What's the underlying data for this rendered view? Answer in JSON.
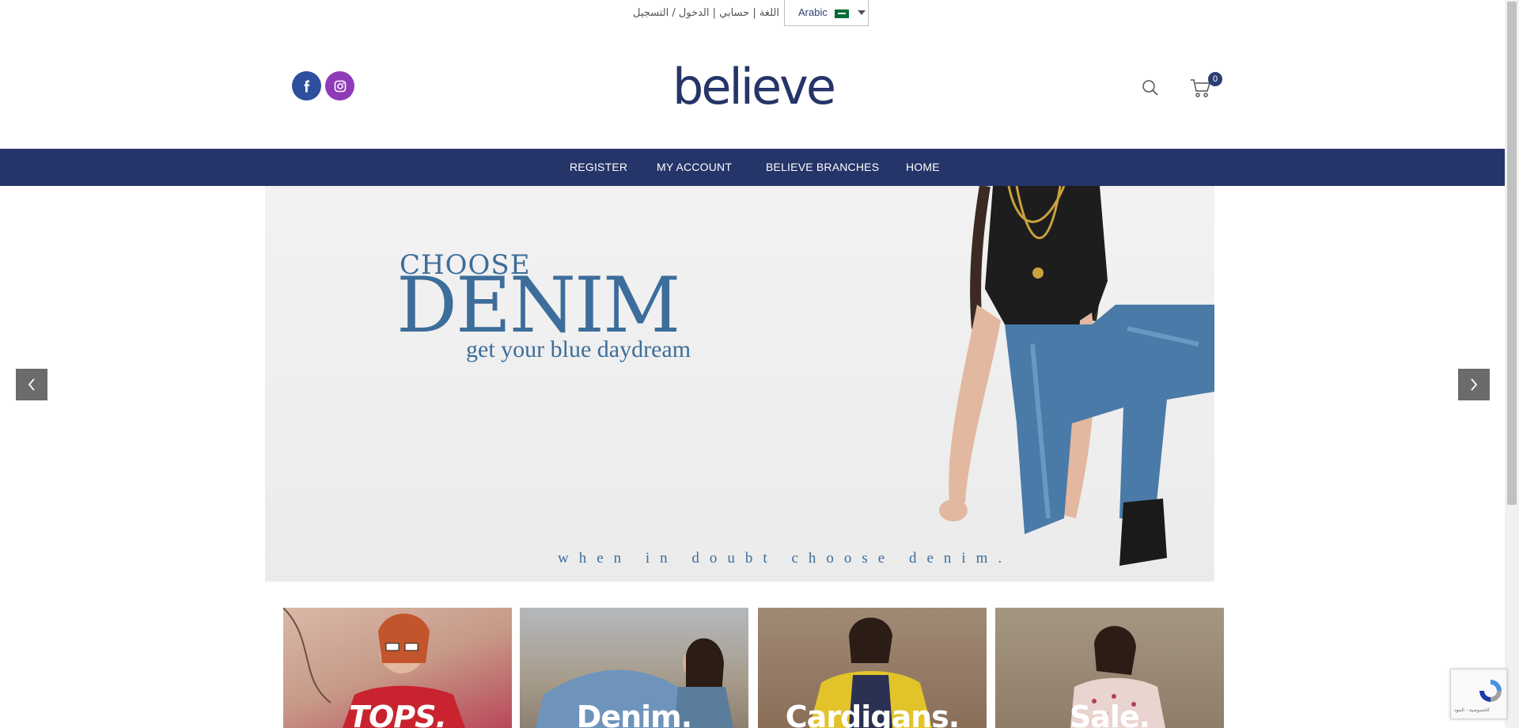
{
  "topbar": {
    "links": "اللغة | حسابي | الدخول / التسجيل",
    "language": "Arabic"
  },
  "header": {
    "logo": "believe",
    "cart_count": "0"
  },
  "nav": {
    "items": [
      "REGISTER",
      "MY ACCOUNT",
      "BELIEVE BRANCHES",
      "HOME"
    ]
  },
  "hero": {
    "choose": "CHOOSE",
    "denim": "DENIM",
    "sub": "get your blue daydream",
    "tagline": "when in doubt choose denim."
  },
  "categories": [
    "TOPS.",
    "Denim.",
    "Cardigans.",
    "Sale."
  ],
  "recaptcha": {
    "text": "الخصوصية - البنود"
  },
  "colors": {
    "brand": "#253569",
    "accent": "#3d6d9a",
    "facebook": "#2e4e9e",
    "instagram": "#8f3bb8"
  }
}
